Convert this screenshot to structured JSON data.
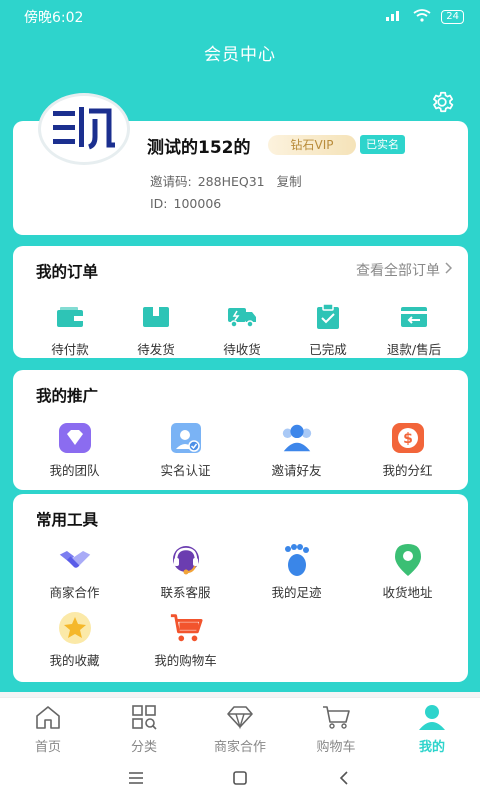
{
  "status_bar": {
    "time": "傍晚6:02",
    "battery": "24"
  },
  "header": {
    "title": "会员中心"
  },
  "profile": {
    "name": "测试的152的",
    "vip_label": "钻石VIP",
    "verified_label": "已实名",
    "invite_label": "邀请码:",
    "invite_code": "288HEQ31",
    "copy_label": "复制",
    "id_label": "ID:",
    "id_value": "100006"
  },
  "orders": {
    "title": "我的订单",
    "view_all": "查看全部订单",
    "items": [
      {
        "label": "待付款",
        "icon": "wallet-icon"
      },
      {
        "label": "待发货",
        "icon": "package-icon"
      },
      {
        "label": "待收货",
        "icon": "truck-icon"
      },
      {
        "label": "已完成",
        "icon": "clipboard-check-icon"
      },
      {
        "label": "退款/售后",
        "icon": "refund-icon"
      }
    ]
  },
  "promotion": {
    "title": "我的推广",
    "items": [
      {
        "label": "我的团队",
        "icon": "diamond-icon"
      },
      {
        "label": "实名认证",
        "icon": "id-card-icon"
      },
      {
        "label": "邀请好友",
        "icon": "users-icon"
      },
      {
        "label": "我的分红",
        "icon": "dollar-icon"
      }
    ]
  },
  "tools": {
    "title": "常用工具",
    "items": [
      {
        "label": "商家合作",
        "icon": "handshake-icon"
      },
      {
        "label": "联系客服",
        "icon": "headset-icon"
      },
      {
        "label": "我的足迹",
        "icon": "footprint-icon"
      },
      {
        "label": "收货地址",
        "icon": "location-pin-icon"
      },
      {
        "label": "我的收藏",
        "icon": "star-icon"
      },
      {
        "label": "我的购物车",
        "icon": "cart-icon"
      }
    ]
  },
  "bottom_nav": {
    "items": [
      {
        "label": "首页",
        "icon": "home-icon"
      },
      {
        "label": "分类",
        "icon": "category-icon"
      },
      {
        "label": "商家合作",
        "icon": "diamond-outline-icon"
      },
      {
        "label": "购物车",
        "icon": "cart-outline-icon"
      },
      {
        "label": "我的",
        "icon": "user-icon",
        "active": true
      }
    ]
  },
  "colors": {
    "accent": "#2ed4cc",
    "vip_text": "#b98c3b",
    "order_icon": "#2ec4b6"
  }
}
